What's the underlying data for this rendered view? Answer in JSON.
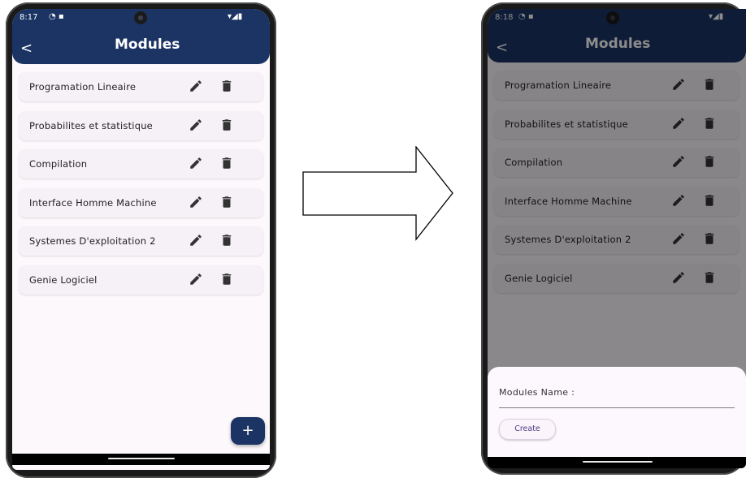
{
  "left_phone": {
    "status_time": "8:17",
    "title": "Modules",
    "back_glyph": "<",
    "modules": [
      "Programation Lineaire",
      "Probabilites et statistique",
      "Compilation",
      "Interface Homme Machine",
      "Systemes D'exploitation 2",
      "Genie Logiciel"
    ],
    "fab_label": "+"
  },
  "right_phone": {
    "status_time": "8:18",
    "title": "Modules",
    "back_glyph": "<",
    "modules": [
      "Programation Lineaire",
      "Probabilites et statistique",
      "Compilation",
      "Interface Homme Machine",
      "Systemes D'exploitation 2",
      "Genie Logiciel"
    ],
    "sheet": {
      "field_label": "Modules Name :",
      "create_label": "Create"
    }
  },
  "icons": {
    "edit": "pencil-icon",
    "delete": "trash-icon",
    "wifi": "wifi-icon",
    "signal": "signal-icon",
    "battery": "battery-icon",
    "arrow": "right-arrow-icon"
  },
  "colors": {
    "app_bar": "#1b3464",
    "card": "#f6f1f7",
    "screen_bg": "#fcf8fc",
    "scrim": "rgba(0,0,0,0.45)"
  }
}
